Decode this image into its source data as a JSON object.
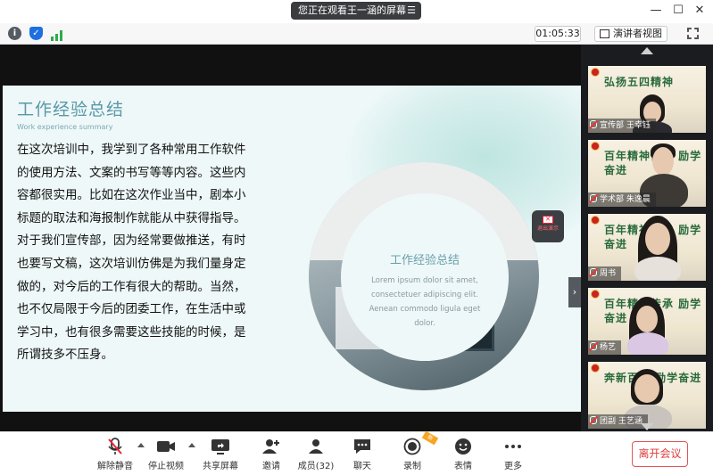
{
  "titlebar": {
    "share_status": "您正在观看王一涵的屏幕",
    "menu_icon": "menu-icon",
    "controls": [
      "—",
      "☐",
      "✕"
    ]
  },
  "toprow": {
    "timer": "01:05:33",
    "view_mode": "演讲者视图",
    "icons": [
      "info-icon",
      "shield-icon",
      "signal-icon",
      "grid-icon",
      "fullscreen-icon"
    ],
    "colors": {
      "shield": "#1e6fe0",
      "signal": "#2dab4b",
      "info": "#555b63"
    }
  },
  "slide": {
    "title": "工作经验总结",
    "subtitle": "Work experience summary",
    "paragraph1": "在这次培训中，我学到了各种常用工作软件的使用方法、文案的书写等等内容。这些内容都很实用。比如在这次作业当中，剧本小标题的取法和海报制作就能从中获得指导。",
    "paragraph2": "对于我们宣传部，因为经常要做推送，有时也要写文稿，这次培训仿佛是为我们量身定做的，对今后的工作有很大的帮助。当然，也不仅局限于今后的团委工作，在生活中或学习中，也有很多需要这些技能的时候，是所谓技多不压身。",
    "circle_title": "工作经验总结",
    "circle_text": "Lorem ipsum dolor sit amet, consectetuer adipiscing elit. Aenean commodo ligula eget dolor.",
    "recording_label": "退出演示"
  },
  "gallery": {
    "tiles": [
      {
        "name": "宣传部 王幸钰",
        "banner": "弘扬五四精神"
      },
      {
        "name": "学术部   朱逸晨",
        "banner": "百年精神传承 励学奋进"
      },
      {
        "name": "周书",
        "banner": "百年精神传承 励学奋进"
      },
      {
        "name": "杨艺",
        "banner": "百年精神传承 励学奋进"
      },
      {
        "name": "团副 王艺涵",
        "banner": "奔新百年 励学奋进"
      }
    ]
  },
  "bottombar": {
    "buttons": [
      {
        "label": "解除静音",
        "icon": "mic-muted-icon"
      },
      {
        "label": "停止视频",
        "icon": "video-camera-icon"
      },
      {
        "label": "共享屏幕",
        "icon": "share-screen-icon"
      },
      {
        "label": "邀请",
        "icon": "invite-user-icon"
      },
      {
        "label": "成员(32)",
        "icon": "members-icon"
      },
      {
        "label": "聊天",
        "icon": "chat-icon"
      },
      {
        "label": "录制",
        "icon": "record-icon"
      },
      {
        "label": "表情",
        "icon": "emoji-icon"
      },
      {
        "label": "更多",
        "icon": "more-icon"
      }
    ],
    "leave_label": "离开会议",
    "new_badge": "新",
    "colors": {
      "leave": "#e03b3b",
      "badge": "#f6a623"
    }
  }
}
